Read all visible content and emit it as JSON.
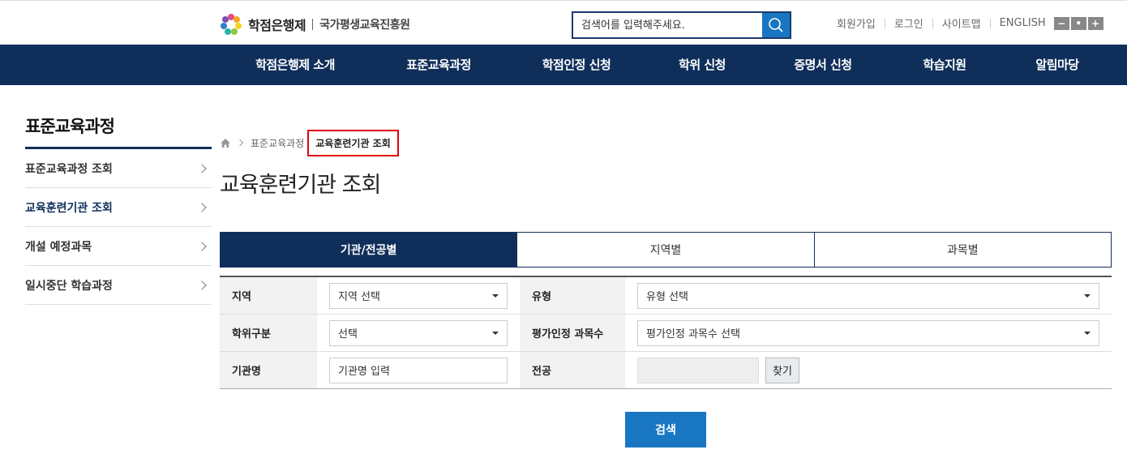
{
  "header": {
    "logo_text": "학점은행제",
    "logo_sub": "국가평생교육진흥원",
    "search_placeholder": "검색어를 입력해주세요.",
    "util_links": [
      "회원가입",
      "로그인",
      "사이트맵",
      "ENGLISH"
    ],
    "zoom_out": "−",
    "zoom_reset": "•",
    "zoom_in": "+"
  },
  "nav": {
    "items": [
      "학점은행제 소개",
      "표준교육과정",
      "학점인정 신청",
      "학위 신청",
      "증명서 신청",
      "학습지원",
      "알림마당"
    ]
  },
  "sidebar": {
    "title": "표준교육과정",
    "items": [
      {
        "label": "표준교육과정 조회",
        "active": false
      },
      {
        "label": "교육훈련기관 조회",
        "active": true
      },
      {
        "label": "개설 예정과목",
        "active": false
      },
      {
        "label": "일시중단 학습과정",
        "active": false
      }
    ]
  },
  "breadcrumb": {
    "parent": "표준교육과정",
    "current": "교육훈련기관 조회"
  },
  "page": {
    "title": "교육훈련기관 조회"
  },
  "tabs": [
    {
      "label": "기관/전공별",
      "active": true
    },
    {
      "label": "지역별",
      "active": false
    },
    {
      "label": "과목별",
      "active": false
    }
  ],
  "form": {
    "region_label": "지역",
    "region_value": "지역 선택",
    "type_label": "유형",
    "type_value": "유형 선택",
    "degree_label": "학위구분",
    "degree_value": "선택",
    "eval_label": "평가인정 과목수",
    "eval_value": "평가인정 과목수 선택",
    "inst_label": "기관명",
    "inst_placeholder": "기관명 입력",
    "major_label": "전공",
    "find_label": "찾기"
  },
  "submit_label": "검색",
  "colors": {
    "navy": "#0f2f5a",
    "blue": "#1976c2",
    "highlight": "#e1000f"
  }
}
